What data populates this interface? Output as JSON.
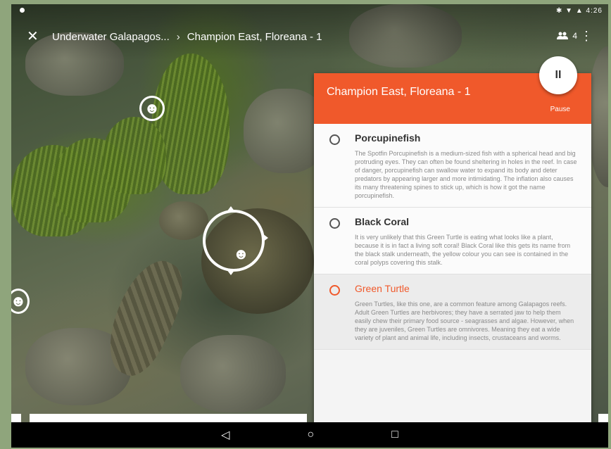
{
  "status_bar": {
    "time": "4:26",
    "icons": "✱ ▼ ▲"
  },
  "header": {
    "close_icon": "✕",
    "breadcrumb": [
      "Underwater Galapagos...",
      "Champion East, Floreana - 1"
    ],
    "separator": "›",
    "participants_icon": "people-icon",
    "participants_count": "4",
    "more_icon": "⋮"
  },
  "poi": {
    "face_glyph": "☻"
  },
  "panel": {
    "title": "Champion East, Floreana - 1",
    "pause_label": "Pause",
    "pause_fab": "II",
    "items": [
      {
        "title": "Porcupinefish",
        "description": "The Spotfin Porcupinefish is a medium-sized fish with a spherical head and big protruding eyes. They can often be found sheltering in holes in the reef. In case of danger, porcupinefish can swallow water to expand its body and deter predators by appearing larger and more intimidating. The inflation also causes its many threatening spines to stick up, which is how it got the name porcupinefish."
      },
      {
        "title": "Black Coral",
        "description": "It is very unlikely that this Green Turtle is eating what looks like a plant, because it is in fact a living soft coral! Black Coral like this gets its name from the black stalk underneath, the yellow colour you can see is contained in the coral polyps covering this stalk."
      },
      {
        "title": "Green Turtle",
        "description": "Green Turtles, like this one, are a common feature among Galapagos reefs. Adult Green Turtles are herbivores; they have a serrated jaw to help them easily chew their primary food source - seagrasses and algae. However, when they are juveniles, Green Turtles are omnivores. Meaning they eat a wide variety of plant and animal life, including insects, crustaceans and worms."
      }
    ],
    "active_index": 2
  },
  "navbar": {
    "back": "◁",
    "home": "○",
    "recents": "□"
  },
  "colors": {
    "accent": "#f0592b"
  }
}
